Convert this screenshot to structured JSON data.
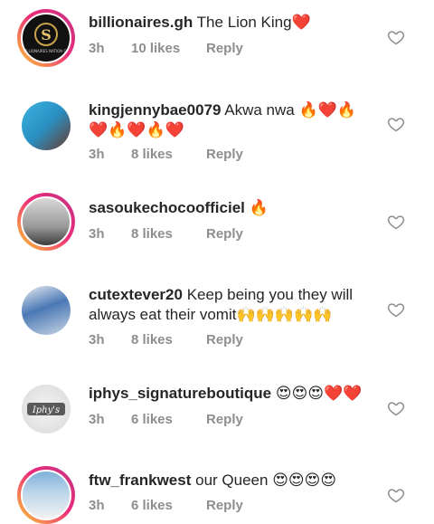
{
  "comments": [
    {
      "username": "billionaires.gh",
      "text": "The Lion King",
      "emojis": "❤️",
      "time": "3h",
      "likes": "10 likes",
      "reply": "Reply",
      "avatar_text": "BILLIONAIRES NATION GH"
    },
    {
      "username": "kingjennybae0079",
      "text": "Akwa nwa",
      "emojis": "🔥❤️🔥",
      "line2": "❤️🔥❤️🔥❤️",
      "time": "3h",
      "likes": "8 likes",
      "reply": "Reply"
    },
    {
      "username": "sasoukechocoofficiel",
      "text": "",
      "emojis": "🔥",
      "time": "3h",
      "likes": "8 likes",
      "reply": "Reply"
    },
    {
      "username": "cutextever20",
      "text": "Keep being you they will",
      "line2_text": "always eat their vomit",
      "line2": "🙌🙌🙌🙌🙌",
      "time": "3h",
      "likes": "8 likes",
      "reply": "Reply"
    },
    {
      "username": "iphys_signatureboutique",
      "text": "",
      "emojis": "😍😍😍❤️❤️",
      "time": "3h",
      "likes": "6 likes",
      "reply": "Reply",
      "avatar_text": "Iphy's"
    },
    {
      "username": "ftw_frankwest",
      "text": "our Queen",
      "emojis": "😍😍😍😍",
      "time": "3h",
      "likes": "6 likes",
      "reply": "Reply"
    }
  ]
}
